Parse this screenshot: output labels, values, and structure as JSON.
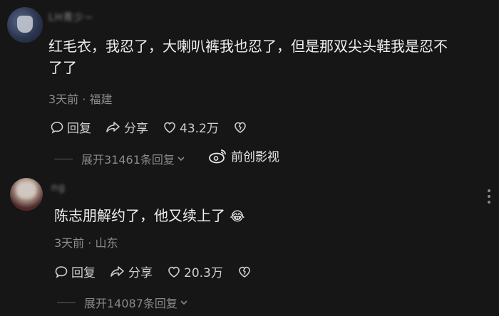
{
  "comments": [
    {
      "username": "LH青少~",
      "text": "红毛衣，我忍了，大喇叭裤我也忍了，但是那双尖头鞋我是忍不了了",
      "time": "3天前",
      "location": "福建",
      "reply_label": "回复",
      "share_label": "分享",
      "likes": "43.2万",
      "expand_label": "展开31461条回复"
    },
    {
      "username": "ng",
      "text": "陈志朋解约了，他又续上了",
      "emoji": "😂",
      "time": "3天前",
      "location": "山东",
      "reply_label": "回复",
      "share_label": "分享",
      "likes": "20.3万",
      "expand_label": "展开14087条回复"
    }
  ],
  "watermark": {
    "text": "前创影视",
    "icon": "weibo-icon"
  },
  "meta_separator": "·",
  "colors": {
    "background": "#161616",
    "text": "#efefef",
    "muted": "#8c8c8c"
  }
}
